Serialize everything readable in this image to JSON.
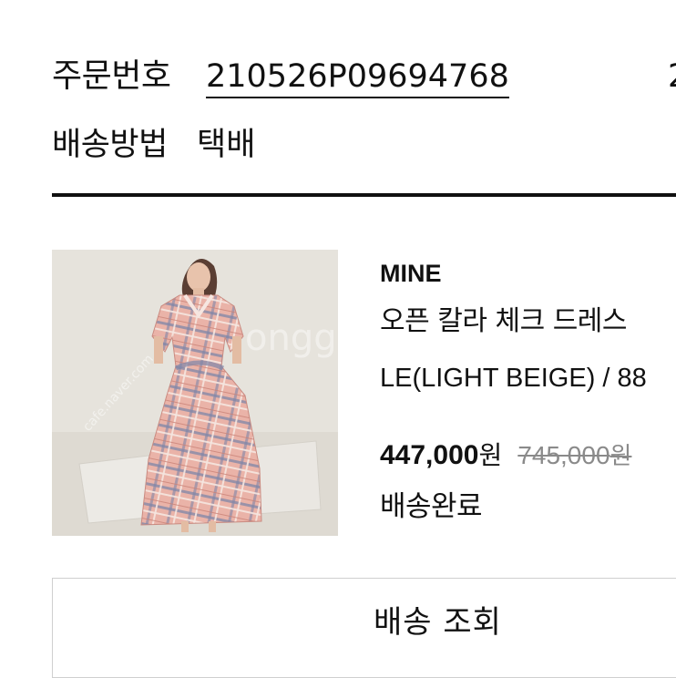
{
  "order": {
    "number_label": "주문번호",
    "number_value": "210526P09694768",
    "date_partial": "2",
    "shipping_method_label": "배송방법",
    "shipping_method_value": "택배"
  },
  "product": {
    "image_alt": "체크 드레스 착용 모델 사진",
    "brand": "MINE",
    "name": "오픈 칼라 체크 드레스",
    "option": "LE(LIGHT BEIGE)  / 88",
    "sale_price": "447,000",
    "sale_price_unit": "원",
    "original_price": "745,000",
    "original_price_unit": "원",
    "status": "배송완료"
  },
  "actions": {
    "track_label": "배송 조회"
  },
  "colors": {
    "text": "#111111",
    "muted": "#8a8a8a",
    "divider": "#111111",
    "button_border": "#cfcfcf",
    "image_background": "#e6e3dc",
    "dress_pink": "#e9a9a0"
  }
}
